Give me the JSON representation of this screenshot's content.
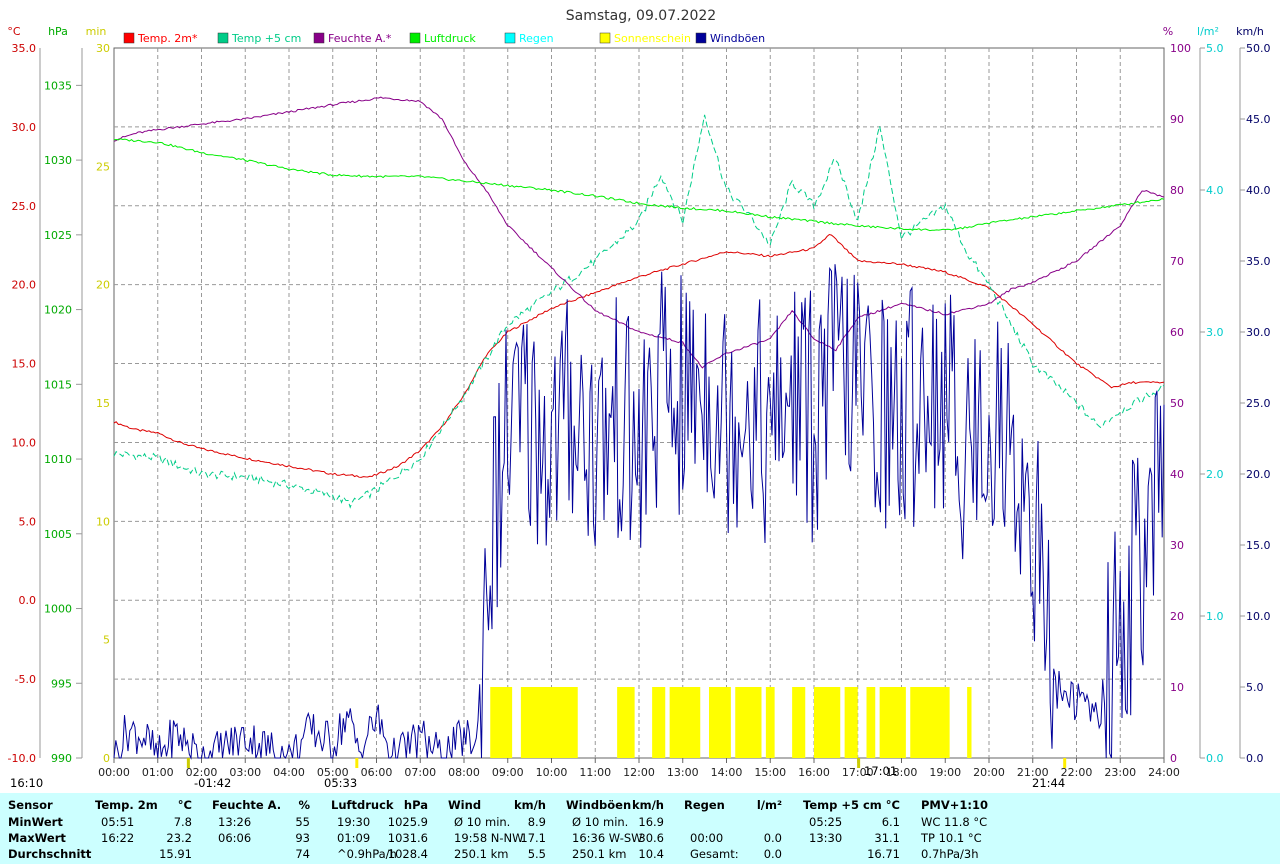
{
  "chart_data": {
    "type": "line",
    "title": "Samstag, 09.07.2022",
    "x_range": [
      0,
      24
    ],
    "x_ticks": [
      "00:00",
      "01:00",
      "02:00",
      "03:00",
      "04:00",
      "05:00",
      "06:00",
      "07:00",
      "08:00",
      "09:00",
      "10:00",
      "11:00",
      "12:00",
      "13:00",
      "14:00",
      "15:00",
      "16:00",
      "17:00",
      "18:00",
      "19:00",
      "20:00",
      "21:00",
      "22:00",
      "23:00",
      "24:00"
    ],
    "axes": {
      "temp": {
        "unit": "°C",
        "range": [
          -10,
          35
        ],
        "ticks": [
          "35.0",
          "30.0",
          "25.0",
          "20.0",
          "15.0",
          "10.0",
          "5.0",
          "0.0",
          "-5.0",
          "-10.0"
        ],
        "color": "#cc0000"
      },
      "pressure": {
        "unit": "hPa",
        "range": [
          990,
          1037.5
        ],
        "ticks": [
          "1035",
          "1030",
          "1025",
          "1020",
          "1015",
          "1010",
          "1005",
          "1000",
          "995",
          "990"
        ],
        "color": "#00aa00"
      },
      "sunshine": {
        "unit": "min",
        "range": [
          0,
          30
        ],
        "ticks": [
          "30",
          "25",
          "20",
          "15",
          "10",
          "5",
          "0"
        ],
        "color": "#cccc00"
      },
      "humidity": {
        "unit": "%",
        "range": [
          0,
          100
        ],
        "ticks": [
          "100",
          "90",
          "80",
          "70",
          "60",
          "50",
          "40",
          "30",
          "20",
          "10",
          "0"
        ],
        "color": "#880088"
      },
      "rain": {
        "unit": "l/m²",
        "range": [
          0,
          5
        ],
        "ticks": [
          "5.0",
          "4.0",
          "3.0",
          "2.0",
          "1.0",
          "0.0"
        ],
        "color": "#00cccc"
      },
      "wind": {
        "unit": "km/h",
        "range": [
          0,
          50
        ],
        "ticks": [
          "50.0",
          "45.0",
          "40.0",
          "35.0",
          "30.0",
          "25.0",
          "20.0",
          "15.0",
          "10.0",
          "5.0",
          "0.0"
        ],
        "color": "#000066"
      }
    },
    "legend": [
      {
        "name": "Temp. 2m*",
        "color": "#ff0000"
      },
      {
        "name": "Temp +5 cm",
        "color": "#00cc88"
      },
      {
        "name": "Feuchte A.*",
        "color": "#880088"
      },
      {
        "name": "Luftdruck",
        "color": "#00ee00"
      },
      {
        "name": "Regen",
        "color": "#00ffff"
      },
      {
        "name": "Sonnenschein",
        "color": "#ffff00"
      },
      {
        "name": "Windböen",
        "color": "#000099"
      }
    ],
    "grid": true,
    "series": [
      {
        "name": "Temp. 2m*",
        "axis": "temp",
        "color": "#dd0000",
        "style": "solid",
        "points": [
          [
            0,
            11.3
          ],
          [
            0.5,
            10.8
          ],
          [
            1,
            10.6
          ],
          [
            1.5,
            10
          ],
          [
            2,
            9.6
          ],
          [
            3,
            9
          ],
          [
            4,
            8.5
          ],
          [
            5,
            8
          ],
          [
            5.85,
            7.8
          ],
          [
            6.5,
            8.5
          ],
          [
            7,
            9.5
          ],
          [
            7.5,
            11
          ],
          [
            8,
            13
          ],
          [
            8.5,
            15.5
          ],
          [
            9,
            17
          ],
          [
            10,
            18.5
          ],
          [
            11,
            19.5
          ],
          [
            12,
            20.5
          ],
          [
            13,
            21.3
          ],
          [
            14,
            22.1
          ],
          [
            15,
            21.8
          ],
          [
            16,
            22.3
          ],
          [
            16.37,
            23.2
          ],
          [
            17,
            21.5
          ],
          [
            18,
            21.3
          ],
          [
            19,
            20.8
          ],
          [
            20,
            19.8
          ],
          [
            21,
            17.5
          ],
          [
            22,
            15
          ],
          [
            22.8,
            13.5
          ],
          [
            23.3,
            13.8
          ],
          [
            24,
            13.8
          ]
        ]
      },
      {
        "name": "Temp +5 cm",
        "axis": "temp",
        "color": "#00cc88",
        "style": "dashed",
        "points": [
          [
            0,
            9.3
          ],
          [
            1,
            9
          ],
          [
            2,
            8
          ],
          [
            3,
            7.8
          ],
          [
            4,
            7.3
          ],
          [
            5,
            6.6
          ],
          [
            5.42,
            6.1
          ],
          [
            6,
            7
          ],
          [
            7,
            9
          ],
          [
            8,
            13
          ],
          [
            9,
            17.5
          ],
          [
            10,
            19.5
          ],
          [
            11,
            21.5
          ],
          [
            12,
            24
          ],
          [
            12.5,
            27
          ],
          [
            13,
            24
          ],
          [
            13.5,
            30.8
          ],
          [
            14,
            26
          ],
          [
            14.5,
            24.5
          ],
          [
            15,
            22.5
          ],
          [
            15.5,
            26.5
          ],
          [
            16,
            25
          ],
          [
            16.5,
            28
          ],
          [
            17,
            24
          ],
          [
            17.5,
            30
          ],
          [
            18,
            23
          ],
          [
            19,
            25
          ],
          [
            19.5,
            22
          ],
          [
            20,
            20
          ],
          [
            21,
            15
          ],
          [
            22,
            12.5
          ],
          [
            22.5,
            11
          ],
          [
            23,
            12
          ],
          [
            24,
            13.5
          ]
        ]
      },
      {
        "name": "Feuchte A.*",
        "axis": "humidity",
        "color": "#880088",
        "style": "solid",
        "points": [
          [
            0,
            87
          ],
          [
            0.5,
            88
          ],
          [
            1,
            88.5
          ],
          [
            2,
            89.3
          ],
          [
            3,
            90
          ],
          [
            4,
            91
          ],
          [
            5,
            92
          ],
          [
            6.1,
            93
          ],
          [
            7,
            92.5
          ],
          [
            7.5,
            90
          ],
          [
            8,
            84
          ],
          [
            8.5,
            80
          ],
          [
            9,
            75
          ],
          [
            10,
            69
          ],
          [
            11,
            63
          ],
          [
            12,
            60
          ],
          [
            13,
            58.5
          ],
          [
            13.44,
            55
          ],
          [
            14,
            57
          ],
          [
            15,
            59
          ],
          [
            15.5,
            63
          ],
          [
            16,
            59
          ],
          [
            16.5,
            57.5
          ],
          [
            17,
            62
          ],
          [
            18,
            64
          ],
          [
            19,
            62.5
          ],
          [
            20,
            64
          ],
          [
            20.5,
            66
          ],
          [
            21,
            67
          ],
          [
            22,
            70
          ],
          [
            23,
            75
          ],
          [
            23.5,
            80
          ],
          [
            24,
            79
          ]
        ]
      },
      {
        "name": "Luftdruck",
        "axis": "pressure",
        "color": "#00ee00",
        "style": "solid",
        "points": [
          [
            0,
            1031.4
          ],
          [
            1,
            1031.2
          ],
          [
            2,
            1030.5
          ],
          [
            3,
            1030
          ],
          [
            4,
            1029.4
          ],
          [
            5,
            1029
          ],
          [
            6,
            1028.9
          ],
          [
            7,
            1028.9
          ],
          [
            8,
            1028.6
          ],
          [
            9,
            1028.3
          ],
          [
            10,
            1028
          ],
          [
            11,
            1027.6
          ],
          [
            12,
            1027.1
          ],
          [
            13,
            1026.8
          ],
          [
            14,
            1026.6
          ],
          [
            15,
            1026.2
          ],
          [
            16,
            1025.9
          ],
          [
            17,
            1025.6
          ],
          [
            18,
            1025.4
          ],
          [
            19,
            1025.3
          ],
          [
            19.5,
            1025.5
          ],
          [
            20,
            1025.8
          ],
          [
            21,
            1026.2
          ],
          [
            22,
            1026.6
          ],
          [
            23,
            1027
          ],
          [
            24,
            1027.4
          ]
        ]
      },
      {
        "name": "Windböen",
        "axis": "wind",
        "color": "#000099",
        "style": "jagged",
        "points": [
          [
            0,
            0
          ],
          [
            0.3,
            2
          ],
          [
            0.7,
            1.5
          ],
          [
            1,
            0
          ],
          [
            1.4,
            1.8
          ],
          [
            2,
            0
          ],
          [
            3,
            1.5
          ],
          [
            4,
            0
          ],
          [
            4.5,
            2
          ],
          [
            5,
            1
          ],
          [
            5.33,
            3
          ],
          [
            5.6,
            0.5
          ],
          [
            6,
            2.8
          ],
          [
            6.4,
            0
          ],
          [
            7,
            1.5
          ],
          [
            7.5,
            0
          ],
          [
            8,
            1.5
          ],
          [
            8.3,
            1
          ],
          [
            8.5,
            13
          ],
          [
            9,
            23
          ],
          [
            9.5,
            24
          ],
          [
            10,
            22
          ],
          [
            10.5,
            25
          ],
          [
            11,
            22
          ],
          [
            11.5,
            24
          ],
          [
            12,
            21
          ],
          [
            12.5,
            26
          ],
          [
            13,
            25
          ],
          [
            13.5,
            27
          ],
          [
            14,
            24
          ],
          [
            14.5,
            26
          ],
          [
            15,
            22
          ],
          [
            15.5,
            26
          ],
          [
            16,
            24
          ],
          [
            16.6,
            28
          ],
          [
            17,
            26
          ],
          [
            17.5,
            25
          ],
          [
            18,
            23
          ],
          [
            18.5,
            27
          ],
          [
            19,
            25
          ],
          [
            19.5,
            22
          ],
          [
            20,
            24
          ],
          [
            20.5,
            22
          ],
          [
            21,
            17
          ],
          [
            21.5,
            5
          ],
          [
            22,
            4
          ],
          [
            22.5,
            3
          ],
          [
            23,
            9
          ],
          [
            23.5,
            15
          ],
          [
            24,
            18
          ]
        ]
      }
    ],
    "sunshine": {
      "axis": "sunshine",
      "color": "#ffff00",
      "intervals": [
        [
          8.6,
          9.1
        ],
        [
          9.3,
          10.6
        ],
        [
          11.5,
          11.9
        ],
        [
          12.3,
          12.6
        ],
        [
          12.7,
          13.4
        ],
        [
          13.6,
          14.1
        ],
        [
          14.2,
          14.8
        ],
        [
          14.9,
          15.1
        ],
        [
          15.5,
          15.8
        ],
        [
          16,
          16.6
        ],
        [
          16.7,
          17
        ],
        [
          17.2,
          17.4
        ],
        [
          17.5,
          18.1
        ],
        [
          18.2,
          19.1
        ],
        [
          19.5,
          19.6
        ]
      ],
      "level": 3
    },
    "sun_markers": [
      {
        "text": "-01:42",
        "kind": "moonrise"
      },
      {
        "text": "05:33",
        "kind": "sunrise"
      },
      {
        "text": "17:01",
        "kind": "moonset"
      },
      {
        "text": "21:44",
        "kind": "sunset"
      }
    ],
    "corner_label": "16:10"
  },
  "stats": {
    "columns": [
      {
        "header": "Sensor",
        "unit": "",
        "rows": [
          "MinWert",
          "MaxWert",
          "Durchschnitt"
        ]
      },
      {
        "header": "Temp. 2m",
        "unit": "°C",
        "rows": [
          [
            "05:51",
            "7.8"
          ],
          [
            "16:22",
            "23.2"
          ],
          [
            "",
            "15.91"
          ]
        ]
      },
      {
        "header": "Feuchte A.",
        "unit": "%",
        "rows": [
          [
            "13:26",
            "55"
          ],
          [
            "06:06",
            "93"
          ],
          [
            "",
            "74"
          ]
        ]
      },
      {
        "header": "Luftdruck",
        "unit": "hPa",
        "rows": [
          [
            "19:30",
            "1025.9"
          ],
          [
            "01:09",
            "1031.6"
          ],
          [
            "^0.9hPa/h",
            "1028.4"
          ]
        ]
      },
      {
        "header": "Wind",
        "unit": "km/h",
        "rows": [
          [
            "Ø 10 min.",
            "8.9"
          ],
          [
            "19:58  N-NW",
            "17.1"
          ],
          [
            "250.1 km",
            "5.5"
          ]
        ]
      },
      {
        "header": "Windböen",
        "unit": "km/h",
        "rows": [
          [
            "Ø 10 min.",
            "16.9"
          ],
          [
            "16:36  W-SW",
            "30.6"
          ],
          [
            "250.1 km",
            "10.4"
          ]
        ]
      },
      {
        "header": "Regen",
        "unit": "l/m²",
        "rows": [
          [
            "",
            ""
          ],
          [
            "00:00",
            "0.0"
          ],
          [
            "Gesamt:",
            "0.0"
          ]
        ]
      },
      {
        "header": "Temp +5 cm",
        "unit": "°C",
        "rows": [
          [
            "05:25",
            "6.1"
          ],
          [
            "13:30",
            "31.1"
          ],
          [
            "",
            "16.71"
          ]
        ]
      },
      {
        "header": "PMV+1:10",
        "unit": "",
        "rows": [
          "WC 11.8 °C",
          "TP 10.1 °C",
          "0.7hPa/3h"
        ]
      }
    ]
  }
}
